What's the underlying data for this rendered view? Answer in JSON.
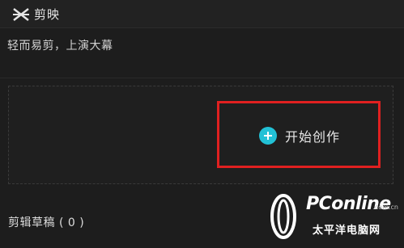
{
  "app": {
    "name": "剪映",
    "logo_icon": "capcut-logo-icon"
  },
  "home": {
    "tagline": "轻而易剪，上演大幕",
    "create_button_label": "开始创作",
    "create_button_icon": "plus-circle-icon",
    "drafts_title": "剪辑草稿 ( 0 )"
  },
  "colors": {
    "background": "#1d1d1d",
    "accent": "#22c1d6",
    "highlight_box": "#e02020"
  },
  "watermark": {
    "brand": "PConline",
    "domain": ".com.cn",
    "subtitle": "太平洋电脑网"
  }
}
